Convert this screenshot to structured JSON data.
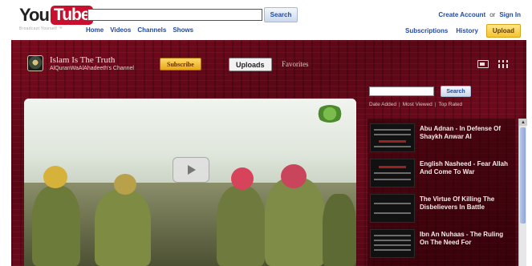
{
  "masthead": {
    "logo_you": "You",
    "logo_tube": "Tube",
    "tagline": "Broadcast Yourself ™",
    "search_value": "",
    "search_button": "Search",
    "nav": [
      "Home",
      "Videos",
      "Channels",
      "Shows"
    ],
    "create_account": "Create Account",
    "or": "or",
    "sign_in": "Sign In",
    "subscriptions": "Subscriptions",
    "history": "History",
    "upload": "Upload"
  },
  "channel": {
    "title": "Islam Is The Truth",
    "subtitle": "AlQuranWaAlAhadeeth's Channel",
    "subscribe_label": "Subscribe",
    "tab_uploads": "Uploads",
    "tab_favorites": "Favorites",
    "player": {
      "overlay_line_1": "",
      "overlay_line_2": ""
    },
    "side_search_value": "",
    "side_search_button": "Search",
    "sort": [
      "Date Added",
      "Most Viewed",
      "Top Rated"
    ],
    "videos": [
      {
        "title": "Abu Adnan - In Defense Of Shaykh Anwar Al",
        "meta": ""
      },
      {
        "title": "English Nasheed - Fear Allah And Come To War",
        "meta": ""
      },
      {
        "title": "The Virtue Of Killing The Disbelievers In Battle",
        "meta": ""
      },
      {
        "title": "Ibn An Nuhaas - The Ruling On The Need For",
        "meta": ""
      }
    ]
  },
  "colors": {
    "brand_red": "#c8102e",
    "channel_bg": "#6d0a1c",
    "link_blue": "#1f4aa8",
    "subscribe_gold": "#e8a81a"
  },
  "icons": [
    "play-icon",
    "grid-view-icon",
    "player-view-icon",
    "scroll-up-icon"
  ]
}
